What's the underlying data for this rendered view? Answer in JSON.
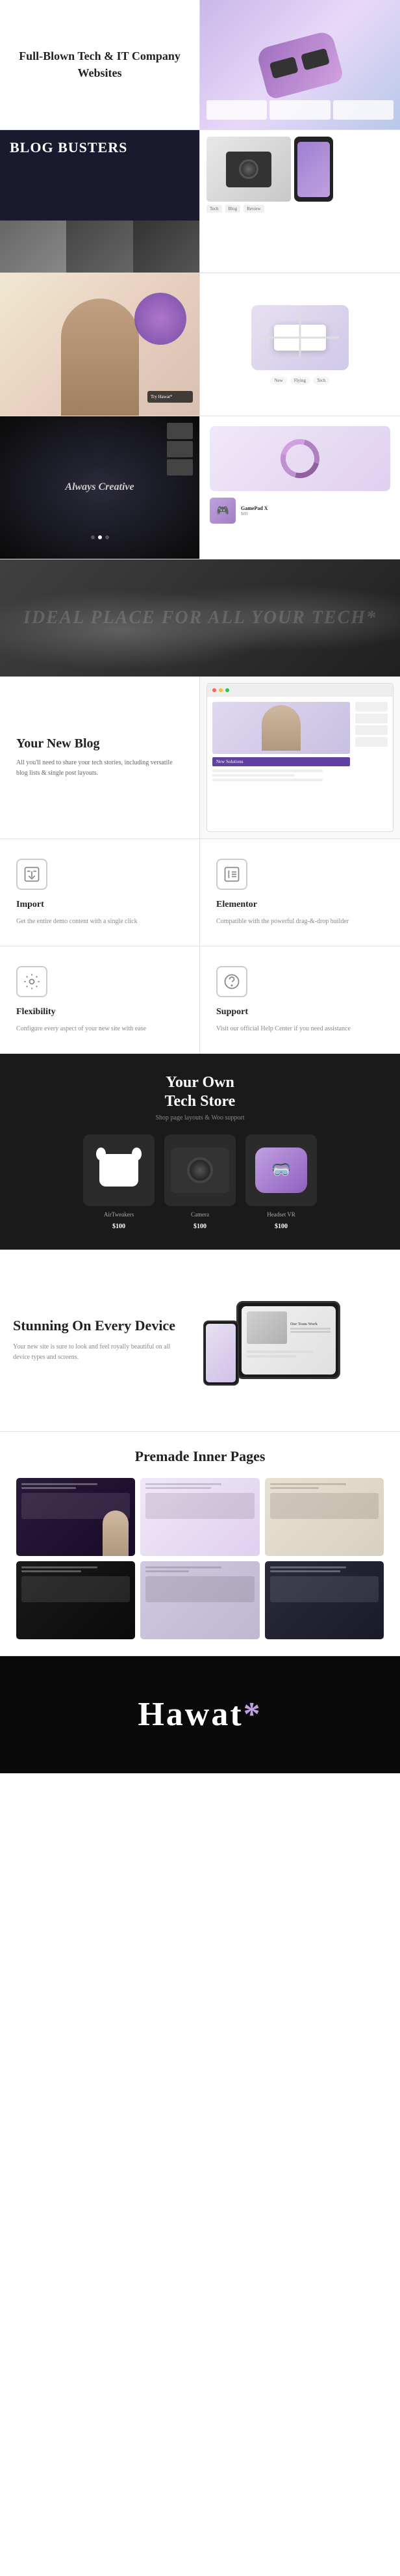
{
  "hero": {
    "left_title": "Full-Blown Tech & IT Company Websites",
    "right_alt": "VR Headset product image"
  },
  "blog": {
    "title": "BLOG BUSTERS",
    "section_title": "Your New Blog",
    "section_desc": "All you'll need to share your tech stories, including versatile blog lists & single post layouts.",
    "new_solutions": "New Solutions"
  },
  "creative": {
    "title": "Always Creative"
  },
  "banner": {
    "text": "Ideal Place For All Your Tech",
    "star": "*"
  },
  "features": [
    {
      "id": "import",
      "title": "Import",
      "desc": "Get the entire demo content with a single click",
      "icon": "import-icon"
    },
    {
      "id": "elementor",
      "title": "Elementor",
      "desc": "Compatible with the powerful drag-&-drop builder",
      "icon": "elementor-icon"
    },
    {
      "id": "flexibility",
      "title": "Flexibility",
      "desc": "Configure every aspect of your new site with ease",
      "icon": "flexibility-icon"
    },
    {
      "id": "support",
      "title": "Support",
      "desc": "Visit our official Help Center if you need assistance",
      "icon": "support-icon"
    }
  ],
  "store": {
    "title": "Your Own\nTech Store",
    "subtitle": "Shop page layouts & Woo support",
    "products": [
      {
        "name": "AirTweakers",
        "price": "$100",
        "type": "earbuds"
      },
      {
        "name": "Camera",
        "price": "$100",
        "type": "camera"
      },
      {
        "name": "Headset VR",
        "price": "$100",
        "type": "vr"
      }
    ]
  },
  "device": {
    "title": "Stunning On Every Device",
    "desc": "Your new site is sure to look and feel royally beautiful on all device types and screens.",
    "tablet_section": "Our Team Work"
  },
  "premade": {
    "title": "Premade Inner Pages"
  },
  "footer": {
    "brand": "Hawat",
    "star": "*"
  }
}
